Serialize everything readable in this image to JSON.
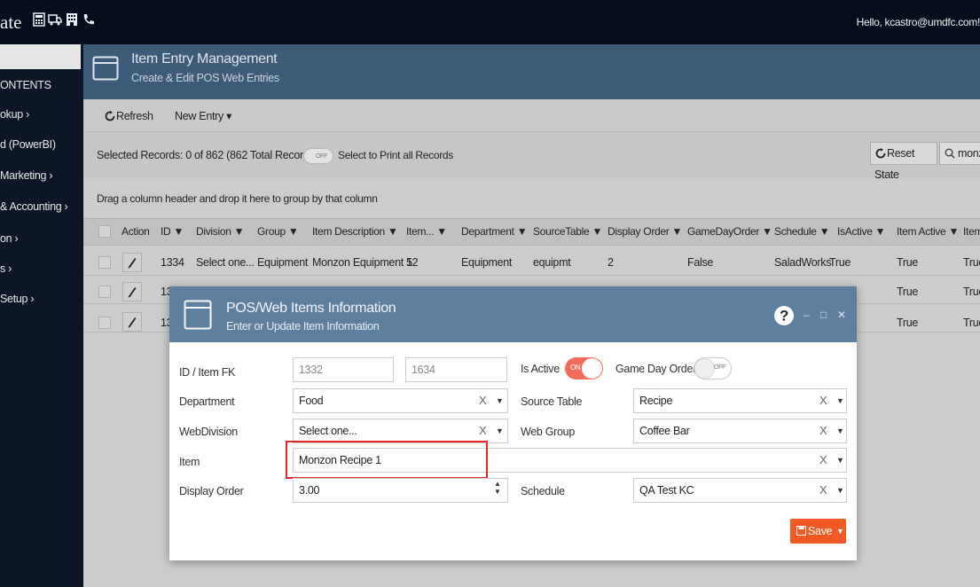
{
  "topbar": {
    "brand": "ate",
    "greeting": "Hello, kcastro@umdfc.com!"
  },
  "sidebar": {
    "items": [
      {
        "label": "ONTENTS"
      },
      {
        "label": "okup  ›"
      },
      {
        "label": "d (PowerBI)"
      },
      {
        "label": "Marketing  ›"
      },
      {
        "label": "& Accounting  ›"
      },
      {
        "label": "on  ›"
      },
      {
        "label": "s  ›"
      },
      {
        "label": "Setup  ›"
      }
    ]
  },
  "header": {
    "title": "Item Entry Management",
    "subtitle": "Create & Edit POS Web Entries"
  },
  "toolbar": {
    "refresh_label": "Refresh",
    "new_entry_label": "New Entry  ▾"
  },
  "selection": {
    "text": "Selected Records: 0 of 862 (862 Total Records)",
    "toggle_label": "OFF",
    "print_label": "Select to Print all Records",
    "reset_label": "Reset State",
    "search_value": "monz"
  },
  "grid": {
    "group_hint": "Drag a column header and drop it here to group by that column",
    "columns": [
      "Action",
      "ID",
      "Division",
      "Group",
      "Item Description",
      "Item...",
      "Department",
      "SourceTable",
      "Display Order",
      "GameDayOrder",
      "Schedule",
      "IsActive",
      "Item Active",
      "Item"
    ],
    "rows": [
      {
        "id": "1334",
        "division": "Select one...",
        "group": "Equipment",
        "description": "Monzon Equipment 1",
        "item": "52",
        "department": "Equipment",
        "source": "equipmt",
        "display_order": "2",
        "gameday": "False",
        "schedule": "SaladWorks",
        "is_active": "True",
        "item_active": "True",
        "item_extra": "True"
      },
      {
        "id": "13",
        "item_active": "True",
        "item_extra": "True"
      },
      {
        "id": "13",
        "item_active": "True",
        "item_extra": "True"
      }
    ]
  },
  "dialog": {
    "title": "POS/Web Items Information",
    "subtitle": "Enter or Update Item Information",
    "help": "?",
    "minimize": "–",
    "maximize": "□",
    "close": "✕",
    "labels": {
      "id_item_fk": "ID / Item FK",
      "department": "Department",
      "webdivision": "WebDivision",
      "item": "Item",
      "display_order": "Display Order",
      "is_active": "Is Active",
      "game_day_order": "Game Day Order",
      "source_table": "Source Table",
      "web_group": "Web Group",
      "schedule": "Schedule"
    },
    "values": {
      "id": "1332",
      "item_fk": "1634",
      "department": "Food",
      "webdivision": "Select one...",
      "item": "Monzon Recipe 1",
      "display_order": "3.00",
      "is_active_toggle": "ON",
      "game_day_toggle": "OFF",
      "source_table": "Recipe",
      "web_group": "Coffee Bar",
      "schedule": "QA Test KC"
    },
    "save_label": "Save",
    "clear_glyph": "X",
    "caret_glyph": "▼"
  }
}
